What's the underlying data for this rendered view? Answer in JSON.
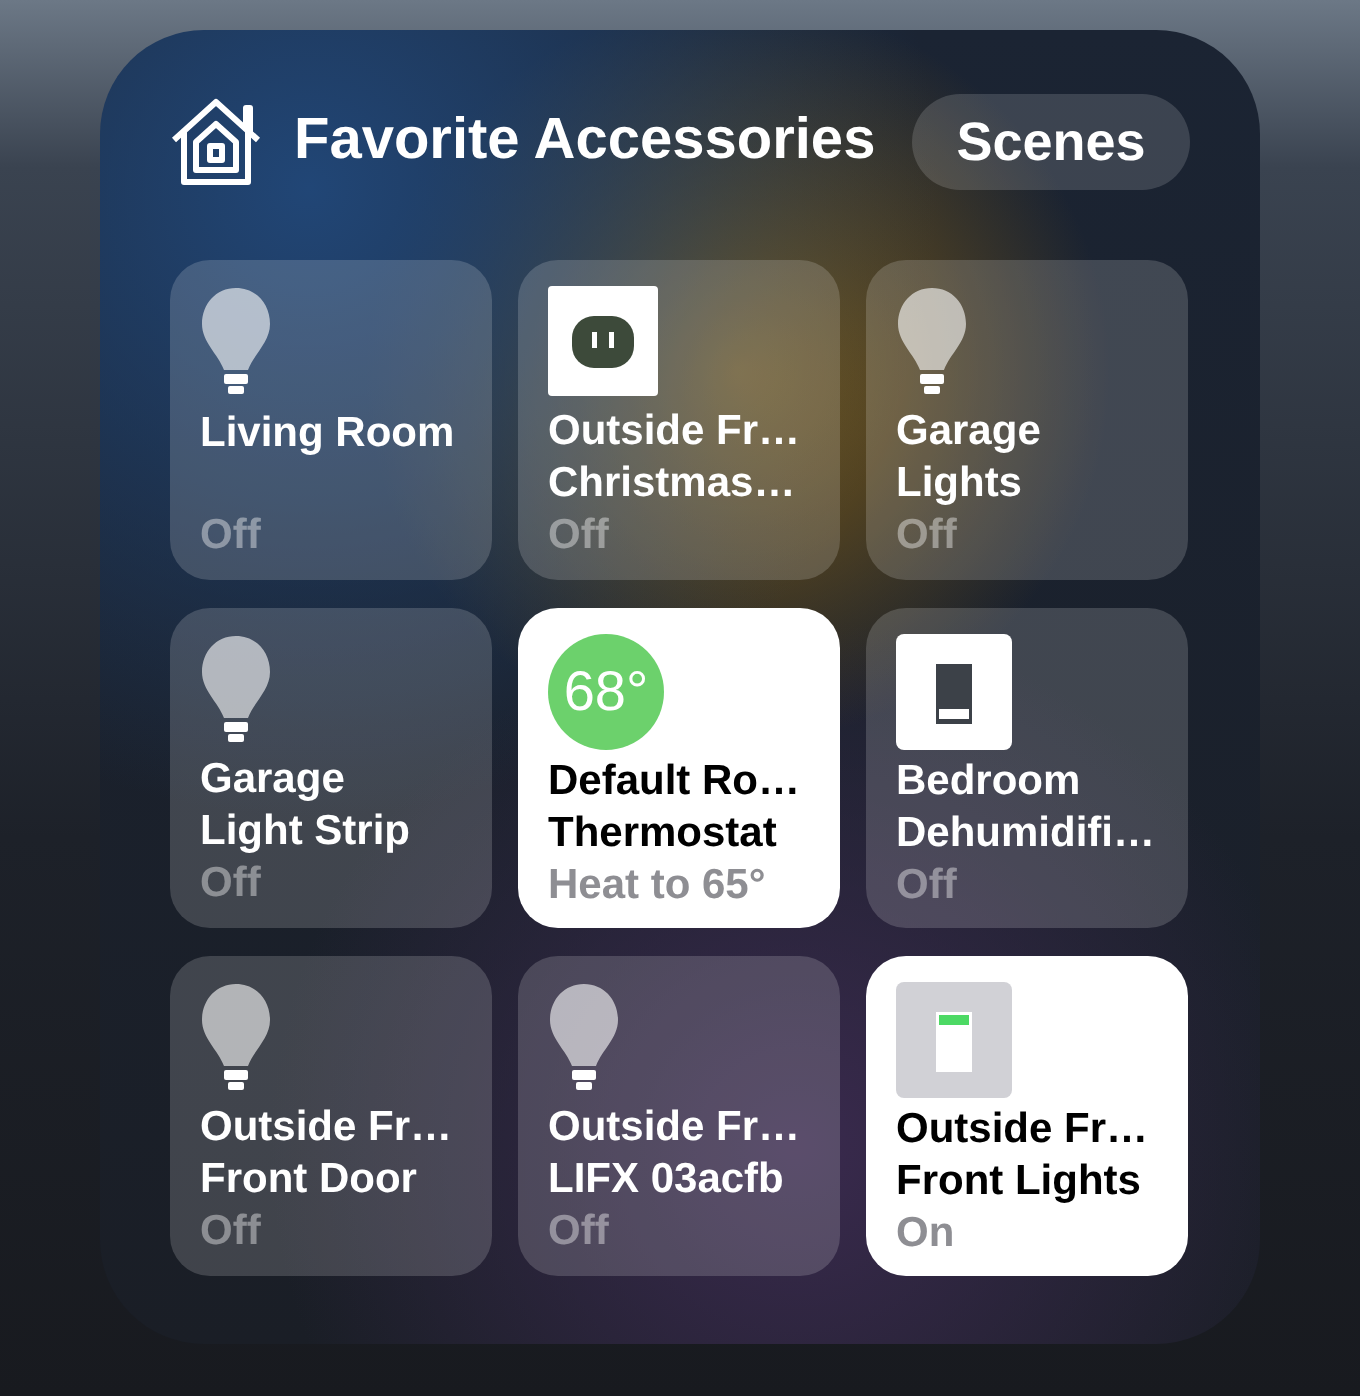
{
  "header": {
    "title": "Favorite Accessories",
    "scenes_button": "Scenes"
  },
  "rows": [
    [
      {
        "kind": "light",
        "name": [
          "Living Room"
        ],
        "status": "Off",
        "on": false
      },
      {
        "kind": "outlet",
        "name": [
          "Outside Fr…",
          "Christmas…"
        ],
        "status": "Off",
        "on": false
      },
      {
        "kind": "light",
        "name": [
          "Garage",
          "Lights"
        ],
        "status": "Off",
        "on": false
      }
    ],
    [
      {
        "kind": "light",
        "name": [
          "Garage",
          "Light Strip"
        ],
        "status": "Off",
        "on": false
      },
      {
        "kind": "thermostat",
        "reading": "68°",
        "name": [
          "Default Ro…",
          "Thermostat"
        ],
        "status": "Heat to 65°",
        "on": true
      },
      {
        "kind": "switch",
        "name": [
          "Bedroom",
          "Dehumidifi…"
        ],
        "status": "Off",
        "on": false
      }
    ],
    [
      {
        "kind": "light",
        "name": [
          "Outside Fr…",
          "Front Door"
        ],
        "status": "Off",
        "on": false
      },
      {
        "kind": "light",
        "name": [
          "Outside Fr…",
          "LIFX 03acfb"
        ],
        "status": "Off",
        "on": false
      },
      {
        "kind": "switch",
        "name": [
          "Outside Fr…",
          "Front Lights"
        ],
        "status": "On",
        "on": true
      }
    ]
  ]
}
